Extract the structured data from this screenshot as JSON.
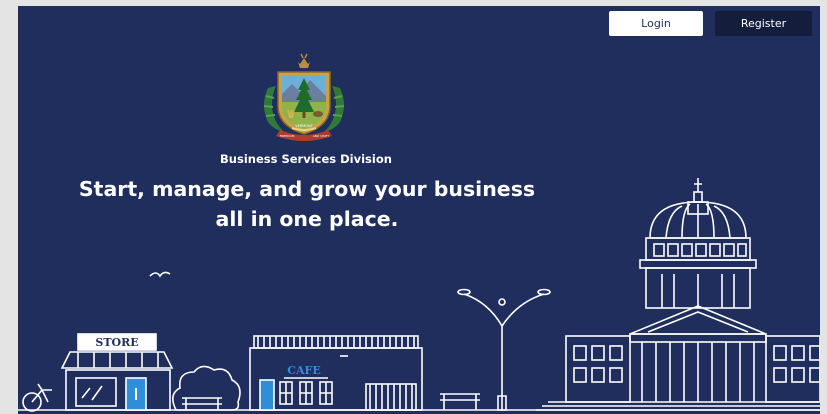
{
  "header": {
    "login_label": "Login",
    "register_label": "Register"
  },
  "hero": {
    "division": "Business Services Division",
    "headline_line1": "Start, manage, and grow your business",
    "headline_line2": "all in one place."
  },
  "seal": {
    "ribbon_text": "VERMONT",
    "motto_left": "FREEDOM",
    "motto_right": "AND UNITY"
  },
  "illustration": {
    "store_sign": "STORE",
    "cafe_sign": "CAFE"
  },
  "colors": {
    "background": "#1f2e5d",
    "register_button": "#141d3c",
    "sign_blue": "#2e8fd8"
  }
}
